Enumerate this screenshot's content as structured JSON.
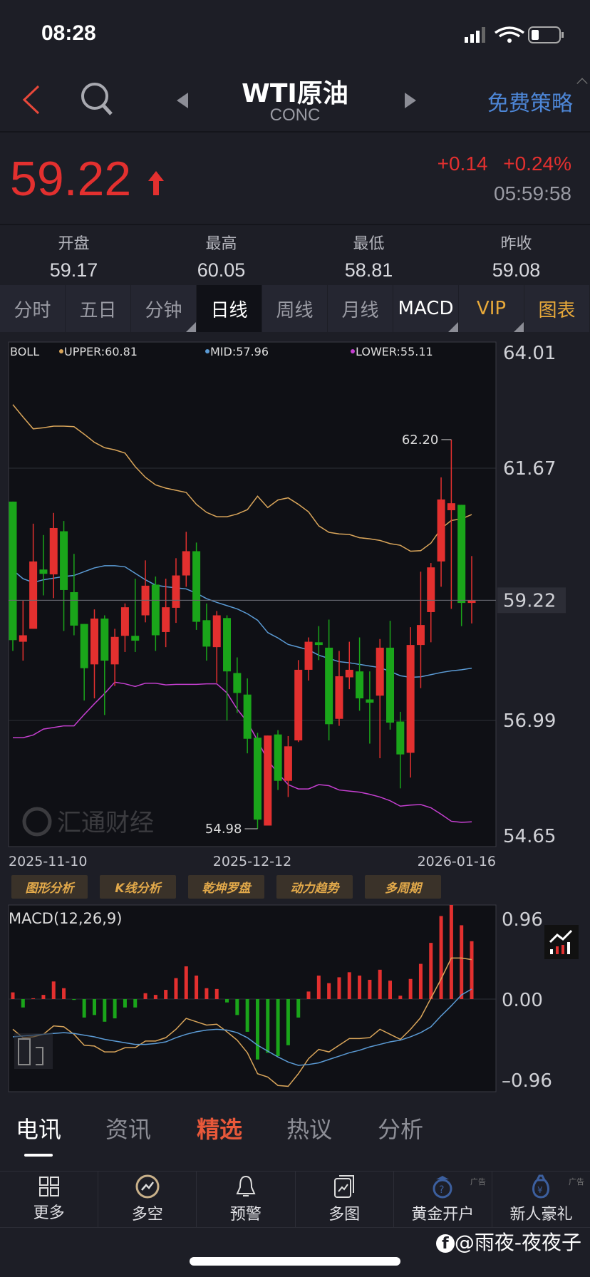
{
  "status": {
    "time": "08:28"
  },
  "header": {
    "title": "WTI原油",
    "subtitle": "CONC",
    "strategy": "免费策略",
    "ad_label": "广告"
  },
  "quote": {
    "price": "59.22",
    "change": "+0.14",
    "change_pct": "+0.24%",
    "time": "05:59:58",
    "direction": "up",
    "up_color": "#e3302f",
    "down_color": "#1aa51a"
  },
  "ohlc": [
    {
      "label": "开盘",
      "value": "59.17"
    },
    {
      "label": "最高",
      "value": "60.05"
    },
    {
      "label": "最低",
      "value": "58.81"
    },
    {
      "label": "昨收",
      "value": "59.08"
    }
  ],
  "tabs": [
    {
      "label": "分时"
    },
    {
      "label": "五日"
    },
    {
      "label": "分钟",
      "dropdown": true
    },
    {
      "label": "日线",
      "active": true
    },
    {
      "label": "周线"
    },
    {
      "label": "月线"
    },
    {
      "label": "MACD",
      "dropdown": true
    },
    {
      "label": "VIP",
      "dropdown": true
    },
    {
      "label": "图表"
    }
  ],
  "tools": [
    "图形分析",
    "K线分析",
    "乾坤罗盘",
    "动力趋势",
    "多周期"
  ],
  "news_tabs": [
    {
      "label": "电讯",
      "active": true
    },
    {
      "label": "资讯"
    },
    {
      "label": "精选",
      "highlight": true
    },
    {
      "label": "热议"
    },
    {
      "label": "分析"
    }
  ],
  "nav": [
    {
      "label": "更多",
      "icon": "grid-icon"
    },
    {
      "label": "多空",
      "icon": "trend-circle-icon"
    },
    {
      "label": "预警",
      "icon": "bell-icon"
    },
    {
      "label": "多图",
      "icon": "multi-chart-icon"
    },
    {
      "label": "黄金开户",
      "icon": "gold-account-icon",
      "ad": true
    },
    {
      "label": "新人豪礼",
      "icon": "gift-bag-icon",
      "ad": true
    }
  ],
  "watermark": "@雨夜-夜夜子",
  "logo_text": "汇通财经",
  "chart_data": [
    {
      "type": "candlestick",
      "indicator": "BOLL",
      "legend": {
        "name": "BOLL",
        "upper": "UPPER:60.81",
        "mid": "MID:57.96",
        "lower": "LOWER:55.11"
      },
      "colors": {
        "upper": "#d9a55a",
        "mid": "#5b9bd5",
        "lower": "#c53fd0"
      },
      "yticks": [
        "64.01",
        "61.67",
        "59.22",
        "56.99",
        "54.65"
      ],
      "ylim": [
        54.65,
        64.01
      ],
      "last_price": 59.22,
      "xticks": [
        "2025-11-10",
        "2025-12-12",
        "2026-01-16"
      ],
      "max_label": "62.20",
      "min_label": "54.98",
      "max_value": 62.2,
      "min_value": 54.98,
      "ohlc": [
        [
          61.05,
          61.05,
          58.28,
          58.48
        ],
        [
          58.45,
          59.21,
          58.1,
          58.57
        ],
        [
          58.69,
          60.64,
          58.69,
          59.94
        ],
        [
          59.79,
          60.43,
          59.31,
          59.71
        ],
        [
          59.7,
          60.84,
          59.26,
          60.56
        ],
        [
          60.5,
          60.69,
          58.65,
          59.41
        ],
        [
          59.37,
          60.08,
          58.57,
          58.75
        ],
        [
          58.78,
          58.78,
          57.36,
          57.96
        ],
        [
          58.03,
          59.05,
          57.4,
          58.88
        ],
        [
          58.88,
          58.94,
          57.09,
          58.1
        ],
        [
          58.03,
          58.69,
          57.63,
          58.54
        ],
        [
          58.56,
          59.16,
          58.26,
          59.09
        ],
        [
          58.56,
          59.62,
          58.26,
          58.47
        ],
        [
          58.94,
          59.96,
          58.81,
          59.49
        ],
        [
          59.51,
          59.66,
          58.28,
          58.57
        ],
        [
          58.63,
          59.62,
          58.35,
          59.09
        ],
        [
          59.08,
          60.0,
          58.8,
          59.68
        ],
        [
          59.68,
          60.49,
          59.47,
          60.13
        ],
        [
          60.13,
          60.29,
          58.67,
          58.82
        ],
        [
          58.85,
          59.16,
          58.1,
          58.36
        ],
        [
          58.35,
          59.02,
          57.69,
          58.94
        ],
        [
          58.89,
          58.94,
          56.99,
          57.9
        ],
        [
          57.87,
          58.16,
          57.13,
          57.5
        ],
        [
          57.47,
          57.77,
          56.38,
          56.65
        ],
        [
          56.67,
          56.76,
          54.98,
          55.15
        ],
        [
          55.04,
          56.71,
          55.04,
          56.71
        ],
        [
          56.73,
          56.81,
          55.7,
          55.87
        ],
        [
          55.87,
          56.7,
          55.57,
          56.51
        ],
        [
          56.62,
          58.11,
          56.59,
          57.93
        ],
        [
          57.93,
          58.53,
          57.73,
          58.45
        ],
        [
          58.44,
          58.74,
          58.11,
          58.39
        ],
        [
          58.34,
          58.86,
          56.62,
          56.92
        ],
        [
          57.02,
          58.28,
          56.89,
          57.81
        ],
        [
          57.79,
          58.45,
          57.57,
          57.93
        ],
        [
          57.9,
          58.53,
          57.17,
          57.4
        ],
        [
          57.38,
          57.9,
          56.56,
          57.32
        ],
        [
          57.45,
          58.5,
          56.29,
          58.34
        ],
        [
          58.34,
          58.84,
          56.82,
          56.95
        ],
        [
          56.97,
          57.15,
          55.73,
          56.36
        ],
        [
          56.39,
          58.72,
          55.93,
          58.39
        ],
        [
          58.39,
          59.75,
          57.59,
          58.76
        ],
        [
          59.0,
          59.91,
          58.44,
          59.83
        ],
        [
          59.94,
          61.5,
          59.47,
          61.09
        ],
        [
          60.89,
          62.2,
          59.06,
          61.02
        ],
        [
          60.99,
          60.99,
          58.74,
          59.17
        ],
        [
          59.17,
          60.04,
          58.79,
          59.22
        ]
      ],
      "upper": [
        62.85,
        62.62,
        62.4,
        62.42,
        62.45,
        62.45,
        62.44,
        62.3,
        62.15,
        62.05,
        62.01,
        61.95,
        61.7,
        61.5,
        61.36,
        61.3,
        61.26,
        61.22,
        61.0,
        60.85,
        60.77,
        60.77,
        60.82,
        60.9,
        61.15,
        60.94,
        61.08,
        61.12,
        61.0,
        60.86,
        60.6,
        60.48,
        60.45,
        60.44,
        60.38,
        60.36,
        60.33,
        60.27,
        60.24,
        60.13,
        60.14,
        60.28,
        60.55,
        60.7,
        60.73,
        60.81
      ],
      "mid": [
        59.78,
        59.62,
        59.55,
        59.6,
        59.63,
        59.66,
        59.68,
        59.75,
        59.82,
        59.86,
        59.86,
        59.84,
        59.72,
        59.6,
        59.5,
        59.47,
        59.45,
        59.43,
        59.35,
        59.25,
        59.18,
        59.12,
        59.06,
        58.97,
        58.85,
        58.62,
        58.52,
        58.4,
        58.35,
        58.3,
        58.2,
        58.14,
        58.08,
        58.06,
        58.03,
        58.0,
        57.97,
        57.9,
        57.82,
        57.79,
        57.8,
        57.84,
        57.88,
        57.91,
        57.93,
        57.96
      ],
      "lower": [
        56.67,
        56.67,
        56.72,
        56.83,
        56.86,
        56.89,
        56.89,
        57.1,
        57.3,
        57.49,
        57.7,
        57.67,
        57.62,
        57.68,
        57.68,
        57.65,
        57.66,
        57.66,
        57.66,
        57.67,
        57.67,
        57.5,
        57.2,
        56.96,
        56.62,
        56.25,
        56.01,
        55.8,
        55.72,
        55.72,
        55.8,
        55.78,
        55.7,
        55.68,
        55.66,
        55.62,
        55.57,
        55.5,
        55.4,
        55.42,
        55.43,
        55.37,
        55.25,
        55.12,
        55.1,
        55.11
      ]
    },
    {
      "type": "bar+line",
      "indicator": "MACD",
      "title": "MACD(12,26,9)",
      "yticks": [
        "0.96",
        "0.00",
        "-0.96"
      ],
      "ylim": [
        -0.96,
        0.96
      ],
      "colors": {
        "dif": "#d9a55a",
        "dea": "#5b9bd5"
      },
      "hist": [
        0.08,
        -0.1,
        0.01,
        0.05,
        0.21,
        0.13,
        -0.01,
        -0.22,
        -0.19,
        -0.27,
        -0.23,
        -0.1,
        -0.1,
        0.07,
        0.05,
        0.11,
        0.25,
        0.39,
        0.28,
        0.13,
        0.12,
        -0.04,
        -0.19,
        -0.39,
        -0.72,
        -0.64,
        -0.68,
        -0.55,
        -0.22,
        0.09,
        0.28,
        0.19,
        0.26,
        0.32,
        0.28,
        0.23,
        0.35,
        0.22,
        0.04,
        0.24,
        0.42,
        0.67,
        0.99,
        1.14,
        0.88,
        0.69
      ],
      "dif": [
        -0.36,
        -0.46,
        -0.45,
        -0.42,
        -0.32,
        -0.33,
        -0.42,
        -0.55,
        -0.56,
        -0.63,
        -0.63,
        -0.58,
        -0.58,
        -0.5,
        -0.5,
        -0.46,
        -0.36,
        -0.23,
        -0.27,
        -0.31,
        -0.3,
        -0.39,
        -0.49,
        -0.64,
        -0.89,
        -0.93,
        -1.03,
        -1.04,
        -0.89,
        -0.71,
        -0.6,
        -0.63,
        -0.55,
        -0.47,
        -0.47,
        -0.46,
        -0.36,
        -0.42,
        -0.48,
        -0.36,
        -0.22,
        0.01,
        0.24,
        0.49,
        0.49,
        0.47
      ],
      "dea": [
        -0.45,
        -0.44,
        -0.43,
        -0.42,
        -0.41,
        -0.4,
        -0.41,
        -0.43,
        -0.45,
        -0.48,
        -0.5,
        -0.52,
        -0.54,
        -0.54,
        -0.53,
        -0.51,
        -0.46,
        -0.42,
        -0.39,
        -0.37,
        -0.36,
        -0.37,
        -0.4,
        -0.46,
        -0.55,
        -0.62,
        -0.69,
        -0.75,
        -0.79,
        -0.78,
        -0.76,
        -0.72,
        -0.68,
        -0.64,
        -0.61,
        -0.57,
        -0.54,
        -0.51,
        -0.49,
        -0.45,
        -0.4,
        -0.33,
        -0.2,
        -0.08,
        0.05,
        0.12
      ]
    }
  ]
}
